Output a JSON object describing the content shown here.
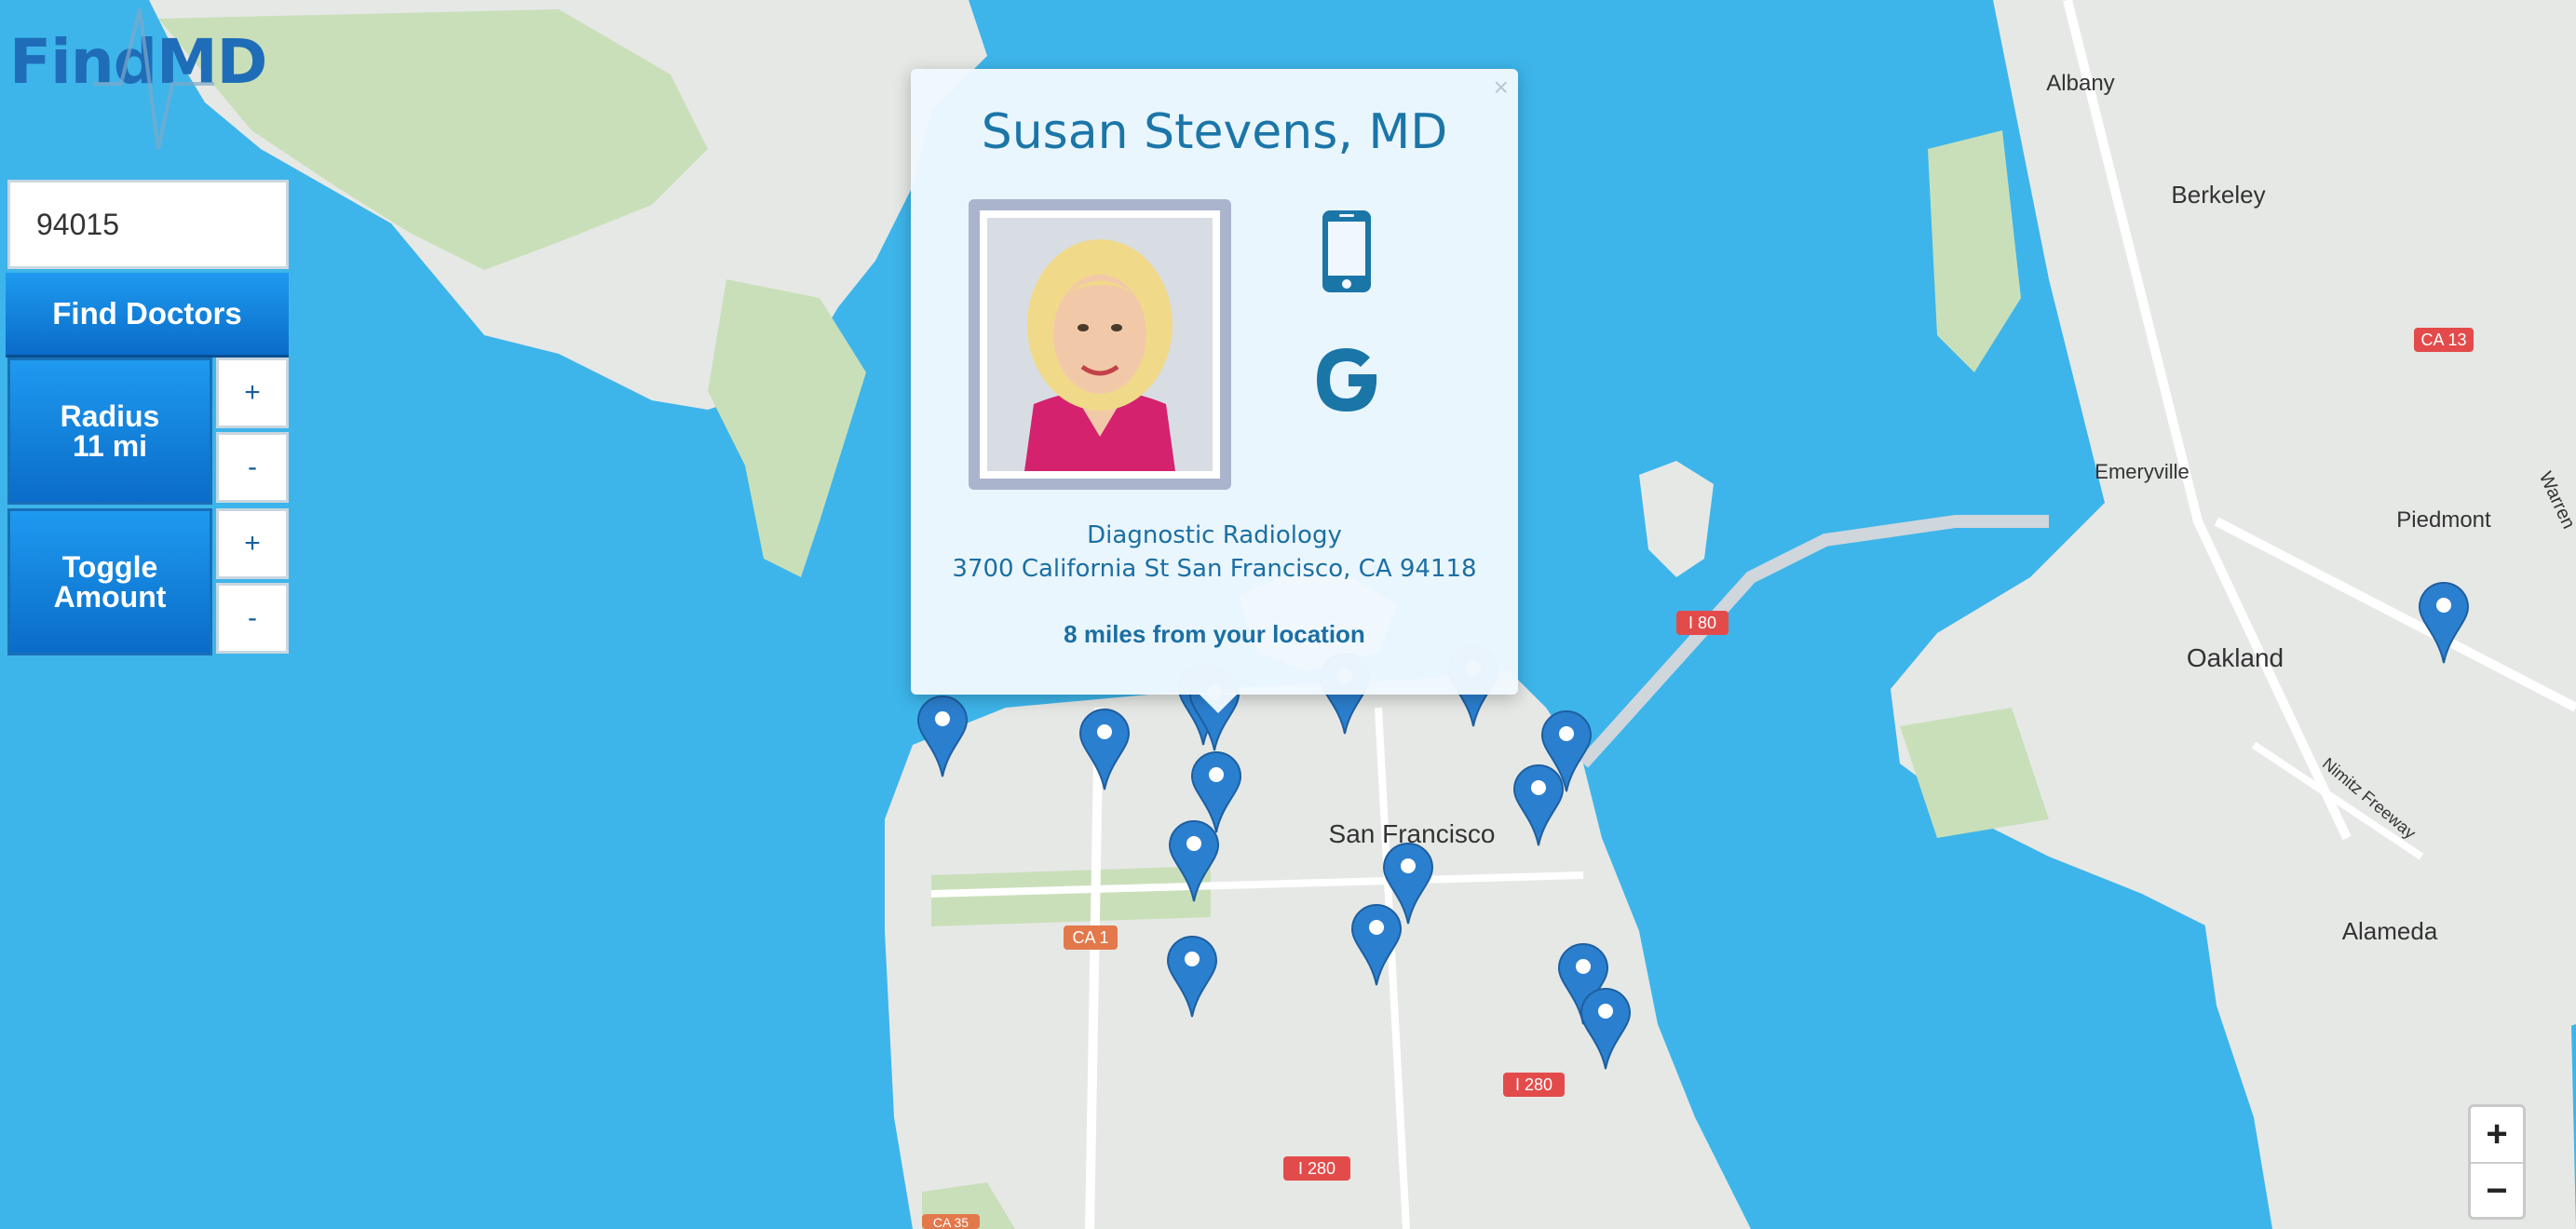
{
  "app": {
    "logo_text": "FindMD"
  },
  "search": {
    "zip_value": "94015",
    "find_label": "Find Doctors"
  },
  "radius": {
    "label": "Radius",
    "value": "11 mi",
    "plus": "+",
    "minus": "-"
  },
  "toggle": {
    "label_line1": "Toggle",
    "label_line2": "Amount",
    "plus": "+",
    "minus": "-"
  },
  "popup": {
    "close": "×",
    "name": "Susan Stevens, MD",
    "specialty": "Diagnostic Radiology",
    "address": "3700 California St San Francisco, CA 94118",
    "distance": "8 miles from your location",
    "phone_icon": "phone-icon",
    "google_icon": "google-icon"
  },
  "map": {
    "places": [
      "Albany",
      "Berkeley",
      "Emeryville",
      "Piedmont",
      "Oakland",
      "San Francisco",
      "Alameda",
      "Nimitz Freeway",
      "Warren"
    ],
    "shields": [
      "CA 13",
      "I 80",
      "CA 1",
      "I 280",
      "I 280",
      "CA 35"
    ],
    "colors": {
      "water": "#3db5ea",
      "land": "#e8e8e8",
      "park": "#c4dfb0",
      "marker": "#2b7fcf",
      "shield": "#e34b4b"
    }
  },
  "zoom": {
    "in": "+",
    "out": "−"
  }
}
